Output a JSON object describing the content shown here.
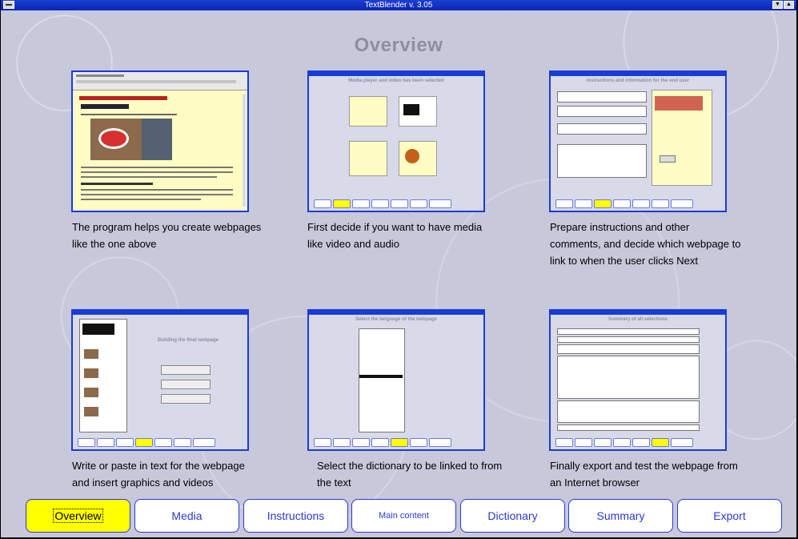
{
  "window": {
    "title": "TextBlender v. 3.05"
  },
  "page": {
    "title": "Overview"
  },
  "cards": [
    {
      "caption": "The program helps you create webpages like the one above"
    },
    {
      "caption": "First decide if you want to have media like video and audio"
    },
    {
      "caption": "Prepare instructions and other comments, and decide which webpage to link to when the user clicks Next"
    },
    {
      "caption": "Write or paste in text for the webpage and insert graphics and videos"
    },
    {
      "caption": "Select the dictionary to be linked to from the text"
    },
    {
      "caption": "Finally export and test the webpage from an Internet browser"
    }
  ],
  "nav": {
    "overview": "Overview",
    "media": "Media",
    "instructions": "Instructions",
    "main_content": "Main content",
    "dictionary": "Dictionary",
    "summary": "Summary",
    "export": "Export"
  },
  "colors": {
    "accent": "#2a39d6",
    "active": "#ffff00",
    "titlebar": "#0a24b8",
    "heading": "#8d8ea1"
  }
}
